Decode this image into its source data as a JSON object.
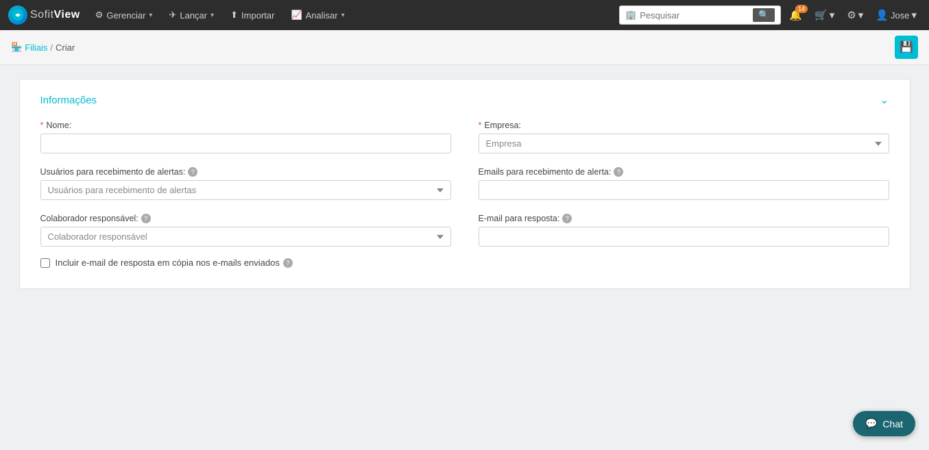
{
  "app": {
    "brand_sofit": "Sofit",
    "brand_view": "View"
  },
  "navbar": {
    "gerenciar_label": "Gerenciar",
    "lancar_label": "Lançar",
    "importar_label": "Importar",
    "analisar_label": "Analisar",
    "search_placeholder": "Pesquisar",
    "user_label": "Jose",
    "notification_count": "14"
  },
  "breadcrumb": {
    "filiais_label": "Filiais",
    "criar_label": "Criar"
  },
  "form": {
    "section_title": "Informações",
    "nome_label": "Nome:",
    "nome_required": "*",
    "empresa_label": "Empresa:",
    "empresa_required": "*",
    "empresa_placeholder": "Empresa",
    "usuarios_label": "Usuários para recebimento de alertas:",
    "usuarios_placeholder": "Usuários para recebimento de alertas",
    "emails_label": "Emails para recebimento de alerta:",
    "colaborador_label": "Colaborador responsável:",
    "colaborador_placeholder": "Colaborador responsável",
    "email_resposta_label": "E-mail para resposta:",
    "include_email_label": "Incluir e-mail de resposta em cópia nos e-mails enviados"
  },
  "chat": {
    "label": "Chat"
  }
}
